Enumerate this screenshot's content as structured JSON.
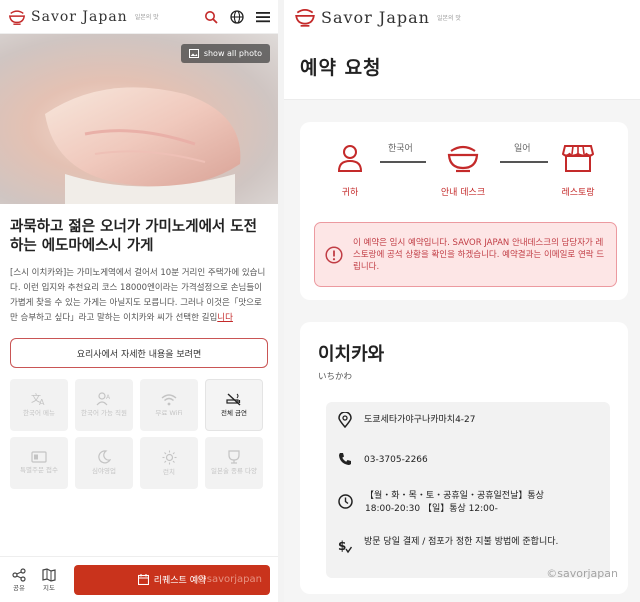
{
  "left": {
    "logo": {
      "text": "Savor Japan",
      "sub": "일본의 맛"
    },
    "hero": {
      "show_all_photo": "show all photo"
    },
    "title": "과묵하고 젊은 오너가 가미노게에서 도전하는 에도마에스시 가게",
    "description": "[스시 이치카와]는 가미노게역에서 걸어서 10분 거리인 주택가에 있습니다. 이런 입지와 추천요리 코스 18000엔이라는 가격설정으로 손님들이 가볍게 찾을 수 있는 가게는 아닐지도 모릅니다. 그러나 이것은「맛으로만 승부하고 싶다」라고 말하는 이치카와 씨가 선택한 길입",
    "read_more": "니다",
    "chef_button": "요리사에서 자세한 내용을 보려면",
    "features": [
      {
        "label": "한국어 메뉴",
        "icon": "translate-icon",
        "on": false
      },
      {
        "label": "한국어 가능 직원",
        "icon": "staff-icon",
        "on": false
      },
      {
        "label": "무료 WiFi",
        "icon": "wifi-icon",
        "on": false
      },
      {
        "label": "전체 금연",
        "icon": "no-smoking-icon",
        "on": true
      },
      {
        "label": "특별주문 접수",
        "icon": "card-icon",
        "on": false
      },
      {
        "label": "심야영업",
        "icon": "moon-icon",
        "on": false
      },
      {
        "label": "런치",
        "icon": "sun-icon",
        "on": false
      },
      {
        "label": "일본술 종류 다양",
        "icon": "sake-icon",
        "on": false
      }
    ],
    "footer": {
      "share": "공유",
      "map": "지도",
      "request": "리퀘스트 예약",
      "watermark": "@savorjapan"
    }
  },
  "right": {
    "logo": {
      "text": "Savor Japan",
      "sub": "일본의 맛"
    },
    "page_title": "예약 요청",
    "steps": {
      "you": "귀하",
      "desk": "안내 데스크",
      "restaurant": "레스토랑",
      "lang1": "한국어",
      "lang2": "일어"
    },
    "alert": "이 예약은 임시 예약입니다. SAVOR JAPAN 안내데스크의 담당자가 레스토랑에 공석 상황을 확인을 하겠습니다. 예약결과는 이메일로 연락 드립니다.",
    "store": {
      "name": "이치카와",
      "kana": "いちかわ",
      "address": "도쿄세타가야구나카마치4-27",
      "phone": "03-3705-2266",
      "hours_line1": "【월・화・목・토・공휴일・공휴일전날】통상",
      "hours_line2": "18:00-20:30 【일】통상 12:00-",
      "payment": "방문 당일 결제 / 점포가 정한 지불 방법에 준합니다.",
      "watermark": "©savorjapan"
    }
  },
  "colors": {
    "accent": "#c9331c",
    "alert_bg": "#fde6e6",
    "alert_text": "#c13d45"
  }
}
